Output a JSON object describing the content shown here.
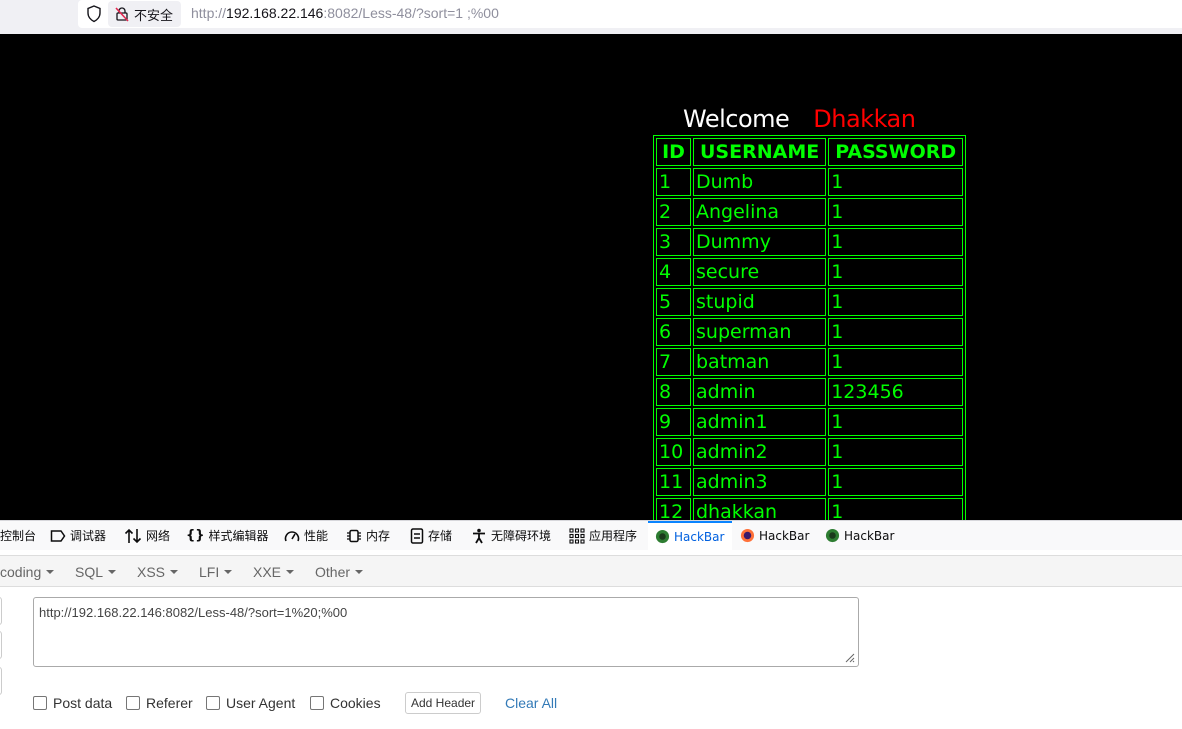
{
  "browser": {
    "security_label": "不安全",
    "url_prefix": "http://",
    "url_host": "192.168.22.146",
    "url_rest": ":8082/Less-48/?sort=1 ;%00"
  },
  "page": {
    "welcome": "Welcome",
    "name": "Dhakkan",
    "table": {
      "headers": [
        "ID",
        "USERNAME",
        "PASSWORD"
      ],
      "rows": [
        [
          "1",
          "Dumb",
          "1"
        ],
        [
          "2",
          "Angelina",
          "1"
        ],
        [
          "3",
          "Dummy",
          "1"
        ],
        [
          "4",
          "secure",
          "1"
        ],
        [
          "5",
          "stupid",
          "1"
        ],
        [
          "6",
          "superman",
          "1"
        ],
        [
          "7",
          "batman",
          "1"
        ],
        [
          "8",
          "admin",
          "123456"
        ],
        [
          "9",
          "admin1",
          "1"
        ],
        [
          "10",
          "admin2",
          "1"
        ],
        [
          "11",
          "admin3",
          "1"
        ],
        [
          "12",
          "dhakkan",
          "1"
        ]
      ]
    }
  },
  "devtools": {
    "tabs": [
      {
        "label": "控制台",
        "icon": "console-icon"
      },
      {
        "label": "调试器",
        "icon": "debugger-icon"
      },
      {
        "label": "网络",
        "icon": "network-icon"
      },
      {
        "label": "样式编辑器",
        "icon": "style-editor-icon"
      },
      {
        "label": "性能",
        "icon": "performance-icon"
      },
      {
        "label": "内存",
        "icon": "memory-icon"
      },
      {
        "label": "存储",
        "icon": "storage-icon"
      },
      {
        "label": "无障碍环境",
        "icon": "accessibility-icon"
      },
      {
        "label": "应用程序",
        "icon": "application-icon"
      },
      {
        "label": "HackBar",
        "icon": "hackbar-green-icon"
      },
      {
        "label": "HackBar",
        "icon": "hackbar-orange-icon"
      },
      {
        "label": "HackBar",
        "icon": "hackbar-green-icon"
      }
    ],
    "active_color": "#0060df"
  },
  "hackbar": {
    "menu": [
      "coding",
      "SQL",
      "XSS",
      "LFI",
      "XXE",
      "Other"
    ],
    "url_value": "http://192.168.22.146:8082/Less-48/?sort=1%20;%00",
    "options": [
      "Post data",
      "Referer",
      "User Agent",
      "Cookies"
    ],
    "add_header": "Add Header",
    "clear_all": "Clear All"
  },
  "colors": {
    "page_bg": "#000000",
    "table_text": "#00ff00",
    "name_color": "#ff0000",
    "link": "#337ab7"
  }
}
